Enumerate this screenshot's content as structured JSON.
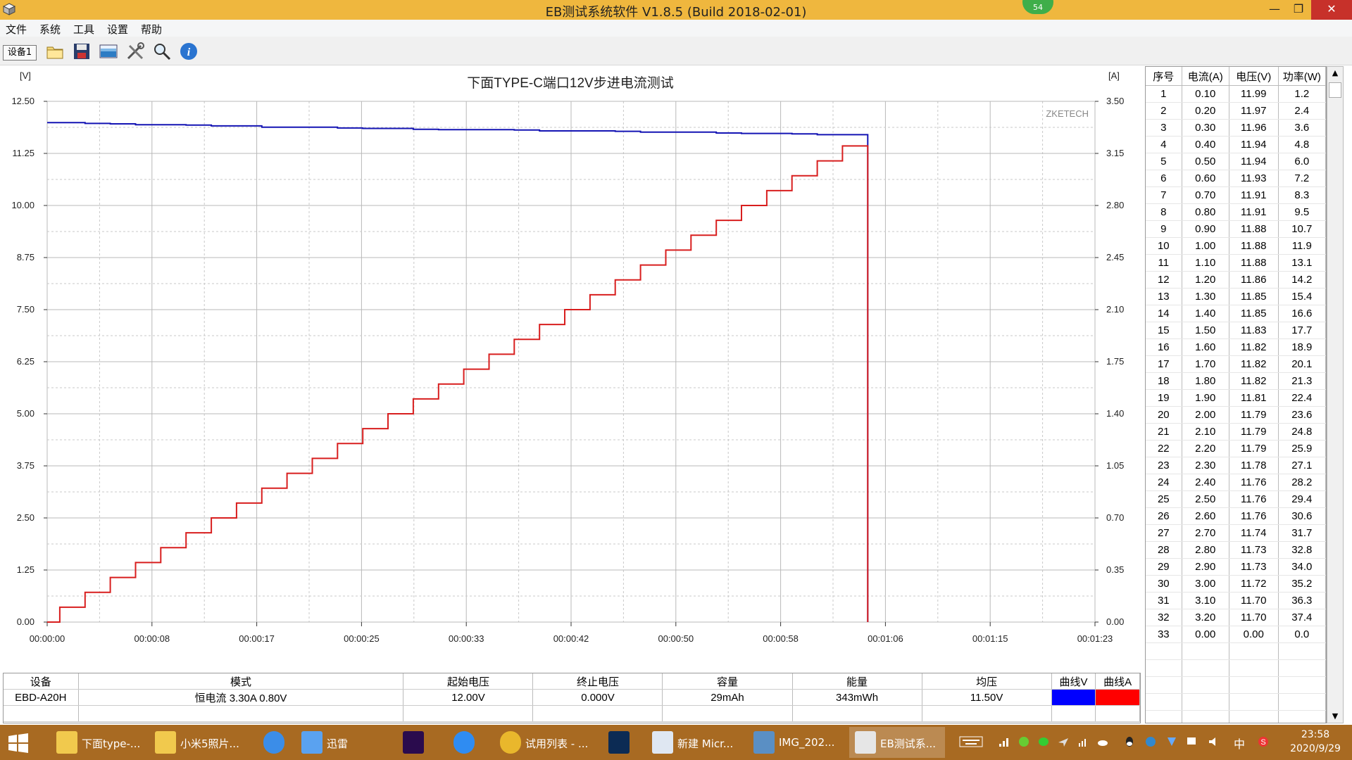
{
  "window": {
    "title": "EB测试系统软件 V1.8.5 (Build 2018-02-01)",
    "badge": "54"
  },
  "menu": [
    "文件",
    "系统",
    "工具",
    "设置",
    "帮助"
  ],
  "toolbar": {
    "tab": "设备1",
    "icons": [
      "folder-icon",
      "save-icon",
      "image-icon",
      "tools-icon",
      "search-icon",
      "info-icon"
    ]
  },
  "chart_data": {
    "type": "line",
    "title": "下面TYPE-C端口12V步进电流测试",
    "watermark": "ZKETECH",
    "ylabel_left": "[V]",
    "ylabel_right": "[A]",
    "x_ticks": [
      "00:00:00",
      "00:00:08",
      "00:00:17",
      "00:00:25",
      "00:00:33",
      "00:00:42",
      "00:00:50",
      "00:00:58",
      "00:01:06",
      "00:01:15",
      "00:01:23"
    ],
    "xlim_seconds": [
      0,
      83
    ],
    "y_left_ticks": [
      "0.00",
      "1.25",
      "2.50",
      "3.75",
      "5.00",
      "6.25",
      "7.50",
      "8.75",
      "10.00",
      "11.25",
      "12.50"
    ],
    "y_left_lim": [
      0,
      12.5
    ],
    "y_right_ticks": [
      "0.00",
      "0.35",
      "0.70",
      "1.05",
      "1.40",
      "1.75",
      "2.10",
      "2.45",
      "2.80",
      "3.15",
      "3.50"
    ],
    "y_right_lim": [
      0,
      3.5
    ],
    "step_seconds": 2,
    "series": [
      {
        "axis": "left",
        "color": "#1414b4",
        "values": [
          11.99,
          11.97,
          11.96,
          11.94,
          11.94,
          11.93,
          11.91,
          11.91,
          11.88,
          11.88,
          11.88,
          11.86,
          11.85,
          11.85,
          11.83,
          11.82,
          11.82,
          11.82,
          11.81,
          11.79,
          11.79,
          11.79,
          11.78,
          11.76,
          11.76,
          11.76,
          11.74,
          11.73,
          11.73,
          11.72,
          11.7,
          11.7,
          0.0
        ]
      },
      {
        "axis": "right",
        "color": "#d81e1e",
        "values": [
          0.1,
          0.2,
          0.3,
          0.4,
          0.5,
          0.6,
          0.7,
          0.8,
          0.9,
          1.0,
          1.1,
          1.2,
          1.3,
          1.4,
          1.5,
          1.6,
          1.7,
          1.8,
          1.9,
          2.0,
          2.1,
          2.2,
          2.3,
          2.4,
          2.5,
          2.6,
          2.7,
          2.8,
          2.9,
          3.0,
          3.1,
          3.2,
          0.0
        ]
      }
    ]
  },
  "table": {
    "headers": [
      "序号",
      "电流(A)",
      "电压(V)",
      "功率(W)"
    ],
    "rows": [
      [
        "1",
        "0.10",
        "11.99",
        "1.2"
      ],
      [
        "2",
        "0.20",
        "11.97",
        "2.4"
      ],
      [
        "3",
        "0.30",
        "11.96",
        "3.6"
      ],
      [
        "4",
        "0.40",
        "11.94",
        "4.8"
      ],
      [
        "5",
        "0.50",
        "11.94",
        "6.0"
      ],
      [
        "6",
        "0.60",
        "11.93",
        "7.2"
      ],
      [
        "7",
        "0.70",
        "11.91",
        "8.3"
      ],
      [
        "8",
        "0.80",
        "11.91",
        "9.5"
      ],
      [
        "9",
        "0.90",
        "11.88",
        "10.7"
      ],
      [
        "10",
        "1.00",
        "11.88",
        "11.9"
      ],
      [
        "11",
        "1.10",
        "11.88",
        "13.1"
      ],
      [
        "12",
        "1.20",
        "11.86",
        "14.2"
      ],
      [
        "13",
        "1.30",
        "11.85",
        "15.4"
      ],
      [
        "14",
        "1.40",
        "11.85",
        "16.6"
      ],
      [
        "15",
        "1.50",
        "11.83",
        "17.7"
      ],
      [
        "16",
        "1.60",
        "11.82",
        "18.9"
      ],
      [
        "17",
        "1.70",
        "11.82",
        "20.1"
      ],
      [
        "18",
        "1.80",
        "11.82",
        "21.3"
      ],
      [
        "19",
        "1.90",
        "11.81",
        "22.4"
      ],
      [
        "20",
        "2.00",
        "11.79",
        "23.6"
      ],
      [
        "21",
        "2.10",
        "11.79",
        "24.8"
      ],
      [
        "22",
        "2.20",
        "11.79",
        "25.9"
      ],
      [
        "23",
        "2.30",
        "11.78",
        "27.1"
      ],
      [
        "24",
        "2.40",
        "11.76",
        "28.2"
      ],
      [
        "25",
        "2.50",
        "11.76",
        "29.4"
      ],
      [
        "26",
        "2.60",
        "11.76",
        "30.6"
      ],
      [
        "27",
        "2.70",
        "11.74",
        "31.7"
      ],
      [
        "28",
        "2.80",
        "11.73",
        "32.8"
      ],
      [
        "29",
        "2.90",
        "11.73",
        "34.0"
      ],
      [
        "30",
        "3.00",
        "11.72",
        "35.2"
      ],
      [
        "31",
        "3.10",
        "11.70",
        "36.3"
      ],
      [
        "32",
        "3.20",
        "11.70",
        "37.4"
      ],
      [
        "33",
        "0.00",
        "0.00",
        "0.0"
      ]
    ]
  },
  "summary": {
    "headers": [
      "设备",
      "模式",
      "起始电压",
      "终止电压",
      "容量",
      "能量",
      "均压",
      "曲线V",
      "曲线A"
    ],
    "device": "EBD-A20H",
    "mode": "恒电流",
    "mode_params": "3.30A  0.80V",
    "start_voltage": "12.00V",
    "end_voltage": "0.000V",
    "capacity": "29mAh",
    "energy": "343mWh",
    "avg_voltage": "11.50V",
    "curve_v_color": "#0000ff",
    "curve_a_color": "#ff0000"
  },
  "taskbar": {
    "items": [
      {
        "label": "下面type-...",
        "icon": "folder-icon"
      },
      {
        "label": "小米5照片...",
        "icon": "folder-icon"
      },
      {
        "label": "",
        "icon": "sogou-icon"
      },
      {
        "label": "迅雷",
        "icon": "thunder-icon"
      },
      {
        "label": "",
        "icon": "premiere-icon"
      },
      {
        "label": "",
        "icon": "browser-icon"
      },
      {
        "label": "试用列表 - ...",
        "icon": "chrome-icon"
      },
      {
        "label": "",
        "icon": "photoshop-icon"
      },
      {
        "label": "新建 Micr...",
        "icon": "document-icon"
      },
      {
        "label": "IMG_202...",
        "icon": "image-icon"
      },
      {
        "label": "EB测试系...",
        "icon": "eb-app-icon"
      }
    ],
    "ime": "中",
    "time": "23:58",
    "date": "2020/9/29"
  }
}
